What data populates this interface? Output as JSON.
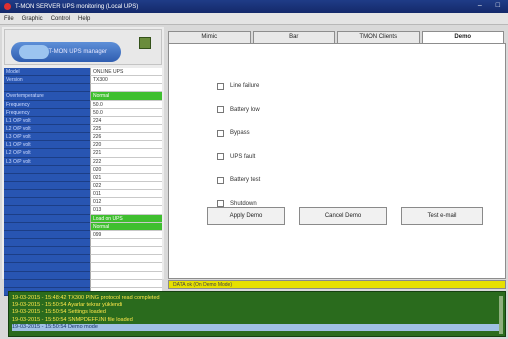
{
  "window": {
    "title": "T-MON SERVER UPS monitoring (Local UPS)",
    "controls": [
      "–",
      "□"
    ]
  },
  "menu": [
    "File",
    "Graphic",
    "Control",
    "Help"
  ],
  "logo": {
    "text": "T-MON UPS manager"
  },
  "tabs": [
    {
      "label": "Mimic",
      "active": false
    },
    {
      "label": "Bar",
      "active": false
    },
    {
      "label": "TMON Clients",
      "active": false
    },
    {
      "label": "Demo",
      "active": true
    }
  ],
  "info_rows": [
    {
      "label": "Model",
      "value": "ONLINE UPS",
      "style": ""
    },
    {
      "label": "Version",
      "value": "TX300",
      "style": ""
    },
    {
      "label": "",
      "value": "",
      "style": ""
    },
    {
      "label": "Overtemperature",
      "value": "Normal",
      "style": "green"
    },
    {
      "label": "Frequency",
      "value": "50.0",
      "style": ""
    },
    {
      "label": "Frequency",
      "value": "50.0",
      "style": ""
    },
    {
      "label": "L1 O/P volt",
      "value": "224",
      "style": ""
    },
    {
      "label": "L2 O/P volt",
      "value": "225",
      "style": ""
    },
    {
      "label": "L3 O/P volt",
      "value": "226",
      "style": ""
    },
    {
      "label": "L1 O/P volt",
      "value": "220",
      "style": ""
    },
    {
      "label": "L2 O/P volt",
      "value": "221",
      "style": ""
    },
    {
      "label": "L3 O/P volt",
      "value": "222",
      "style": ""
    },
    {
      "label": "",
      "value": "020",
      "style": ""
    },
    {
      "label": "",
      "value": "021",
      "style": ""
    },
    {
      "label": "",
      "value": "022",
      "style": ""
    },
    {
      "label": "",
      "value": "011",
      "style": ""
    },
    {
      "label": "",
      "value": "012",
      "style": ""
    },
    {
      "label": "",
      "value": "013",
      "style": ""
    },
    {
      "label": "",
      "value": "Load on UPS",
      "style": "green"
    },
    {
      "label": "",
      "value": "Normal",
      "style": "green"
    },
    {
      "label": "",
      "value": "099",
      "style": ""
    },
    {
      "label": "",
      "value": "",
      "style": ""
    },
    {
      "label": "",
      "value": "",
      "style": ""
    },
    {
      "label": "",
      "value": "",
      "style": ""
    },
    {
      "label": "",
      "value": "",
      "style": ""
    },
    {
      "label": "",
      "value": "",
      "style": ""
    },
    {
      "label": "",
      "value": "",
      "style": ""
    },
    {
      "label": "",
      "value": "",
      "style": ""
    }
  ],
  "demo": {
    "checks": [
      "Line failure",
      "Battery low",
      "Bypass",
      "UPS fault",
      "Battery test",
      "Shutdown"
    ],
    "apply": "Apply Demo",
    "cancel": "Cancel Demo",
    "test_email": "Test e-mail"
  },
  "status": "DATA ok (On Demo Mode)",
  "log": [
    {
      "text": "19-03-2015 - 15:48:42  TX300 PING protocol read completed",
      "selected": false
    },
    {
      "text": "19-03-2015 - 15:50:54  Ayarlar tekrar yüklendi",
      "selected": false
    },
    {
      "text": "19-03-2015 - 15:50:54  Settings loaded",
      "selected": false
    },
    {
      "text": "19-03-2015 - 15:50:54  SNMPDEFF.INI file loaded",
      "selected": false
    },
    {
      "text": "19-03-2015 - 15:50:54  Demo mode",
      "selected": true
    }
  ]
}
